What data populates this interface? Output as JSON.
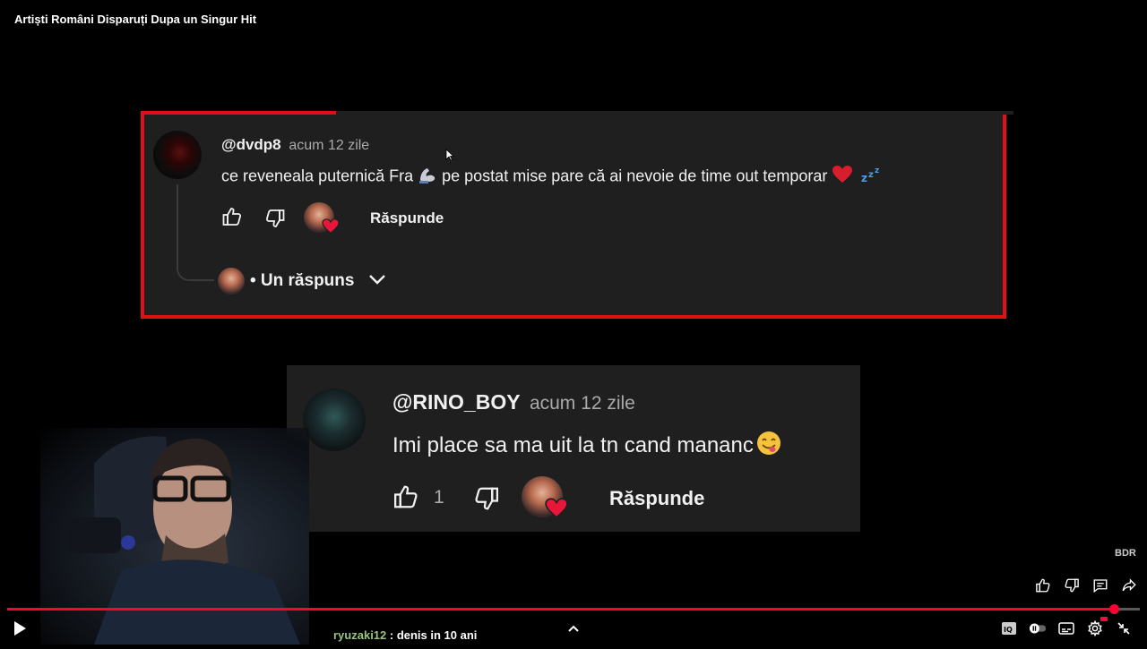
{
  "video": {
    "title": "Artiști Români Disparuți Dupa un Singur Hit"
  },
  "comment1": {
    "username": "@dvdp8",
    "time": "acum 12 zile",
    "text_before": "ce reveneala puternică Fra ",
    "text_after": "pe postat mise pare că ai nevoie de time out temporar ",
    "reply_label": "Răspunde",
    "replies_label": "• Un răspuns"
  },
  "comment2": {
    "username": "@RINO_BOY",
    "time": "acum 12 zile",
    "text": "Imi place sa ma uit la tn cand mananc",
    "likes": "1",
    "reply_label": "Răspunde"
  },
  "player": {
    "watermark": "BDR",
    "progress": 0.977,
    "chat_user": "ryuzaki12",
    "chat_message": " : denis in 10 ani"
  },
  "colors": {
    "accent": "#e01018",
    "progress": "#ff0033",
    "card": "#1f1f1f"
  }
}
